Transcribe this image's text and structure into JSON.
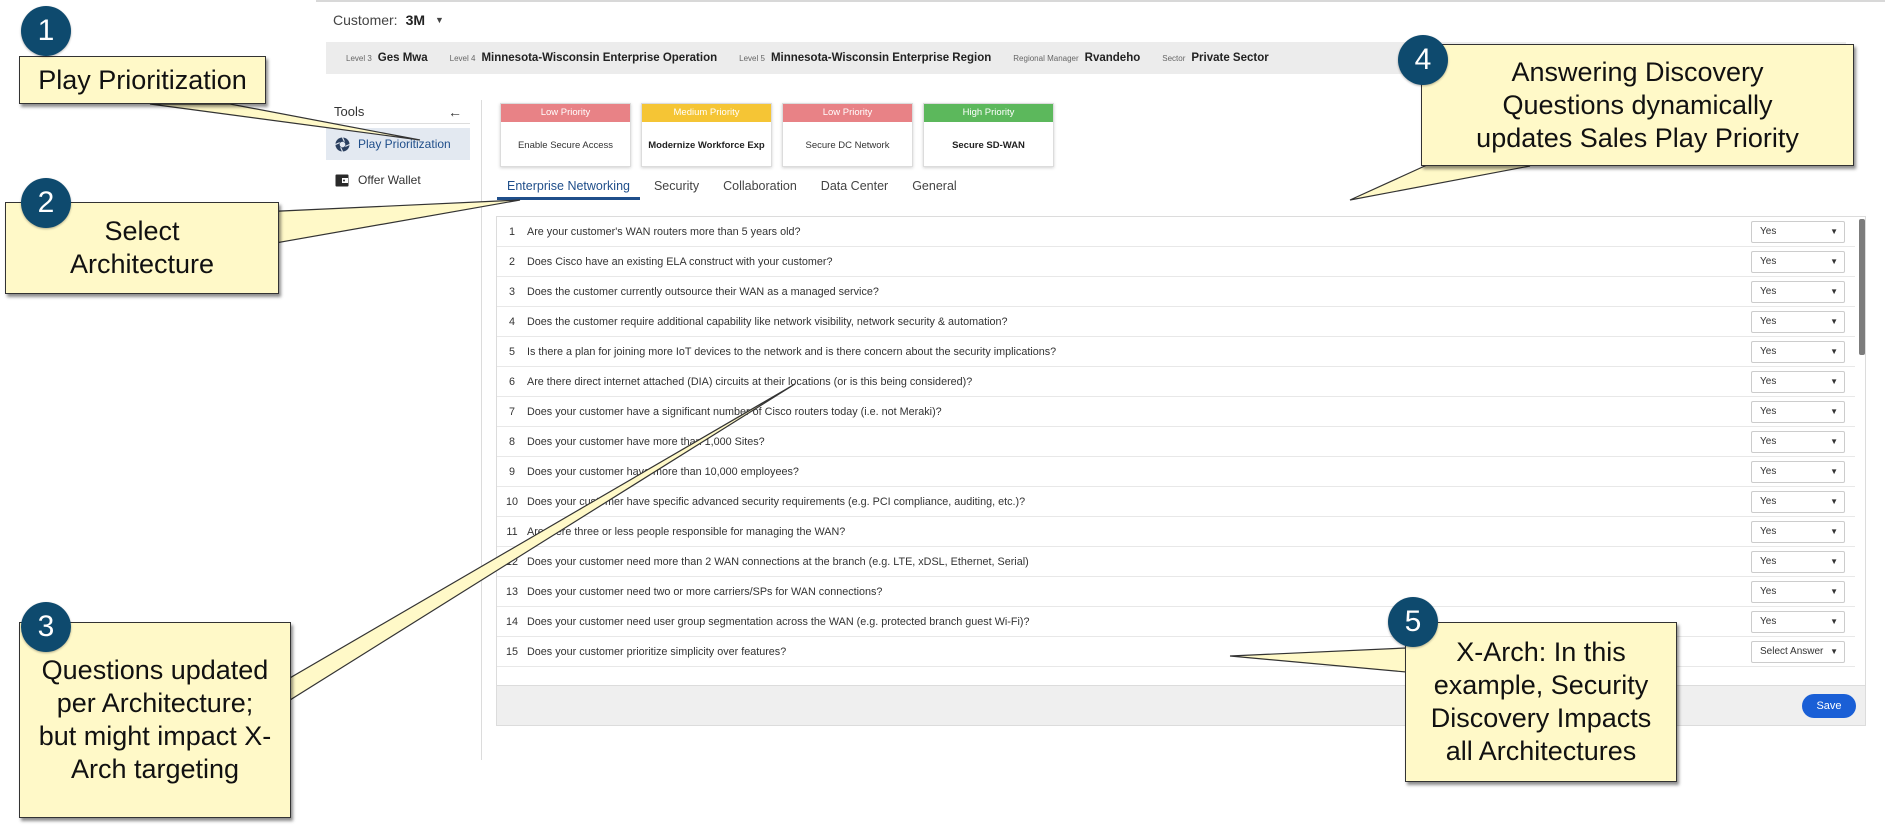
{
  "customer": {
    "label": "Customer:",
    "value": "3M"
  },
  "hierarchy": [
    {
      "key": "Level 3",
      "value": "Ges Mwa"
    },
    {
      "key": "Level 4",
      "value": "Minnesota-Wisconsin Enterprise Operation"
    },
    {
      "key": "Level 5",
      "value": "Minnesota-Wisconsin Enterprise Region"
    },
    {
      "key": "Regional Manager",
      "value": "Rvandeho"
    },
    {
      "key": "Sector",
      "value": "Private Sector"
    }
  ],
  "tools": {
    "title": "Tools",
    "items": [
      {
        "label": "Play Prioritization",
        "icon": "aperture-icon",
        "active": true
      },
      {
        "label": "Offer Wallet",
        "icon": "wallet-icon",
        "active": false
      }
    ]
  },
  "priority_cards": [
    {
      "priority": "Low Priority",
      "play": "Enable Secure Access",
      "color": "#e88286"
    },
    {
      "priority": "Medium Priority",
      "play": "Modernize Workforce Exp",
      "color": "#f5c535"
    },
    {
      "priority": "Low Priority",
      "play": "Secure DC Network",
      "color": "#e88286"
    },
    {
      "priority": "High Priority",
      "play": "Secure SD-WAN",
      "color": "#5cb85c"
    }
  ],
  "tabs": [
    "Enterprise Networking",
    "Security",
    "Collaboration",
    "Data Center",
    "General"
  ],
  "questions": [
    {
      "num": "1",
      "text": "Are your customer's WAN routers more than 5 years old?",
      "answer": "Yes"
    },
    {
      "num": "2",
      "text": "Does Cisco have an existing ELA construct with your customer?",
      "answer": "Yes"
    },
    {
      "num": "3",
      "text": "Does the customer currently outsource their WAN as a managed service?",
      "answer": "Yes"
    },
    {
      "num": "4",
      "text": "Does the customer require additional capability like network visibility, network security & automation?",
      "answer": "Yes"
    },
    {
      "num": "5",
      "text": "Is there a plan for joining more IoT devices to the network and is there concern about the security implications?",
      "answer": "Yes"
    },
    {
      "num": "6",
      "text": "Are there direct internet attached (DIA) circuits at their locations (or is this being considered)?",
      "answer": "Yes"
    },
    {
      "num": "7",
      "text": "Does your customer have a significant number of Cisco routers today (i.e. not Meraki)?",
      "answer": "Yes"
    },
    {
      "num": "8",
      "text": "Does your customer have more than 1,000 Sites?",
      "answer": "Yes"
    },
    {
      "num": "9",
      "text": "Does your customer have more than 10,000 employees?",
      "answer": "Yes"
    },
    {
      "num": "10",
      "text": "Does your customer have specific advanced security requirements (e.g. PCI compliance, auditing, etc.)?",
      "answer": "Yes"
    },
    {
      "num": "11",
      "text": "Are there three or less people responsible for managing the WAN?",
      "answer": "Yes"
    },
    {
      "num": "12",
      "text": "Does your customer need more than 2 WAN connections at the branch (e.g. LTE, xDSL, Ethernet, Serial)",
      "answer": "Yes"
    },
    {
      "num": "13",
      "text": "Does your customer need two or more carriers/SPs for WAN connections?",
      "answer": "Yes"
    },
    {
      "num": "14",
      "text": "Does your customer need user group segmentation across the WAN (e.g. protected branch guest Wi-Fi)?",
      "answer": "Yes"
    },
    {
      "num": "15",
      "text": "Does your customer prioritize simplicity over features?",
      "answer": "Select Answer"
    }
  ],
  "save_label": "Save",
  "callouts": [
    {
      "num": "1",
      "text": "Play Prioritization"
    },
    {
      "num": "2",
      "text": "Select Architecture"
    },
    {
      "num": "3",
      "text": "Questions updated per Architecture; but might impact X-Arch targeting"
    },
    {
      "num": "4",
      "text": "Answering Discovery Questions dynamically updates Sales Play Priority"
    },
    {
      "num": "5",
      "text": "X-Arch: In this example, Security Discovery Impacts all Architectures"
    }
  ],
  "colors": {
    "accent": "#1f4e8a",
    "save": "#1a5fd6",
    "callout_fill": "#fff9c8",
    "badge": "#0e4a6e"
  }
}
